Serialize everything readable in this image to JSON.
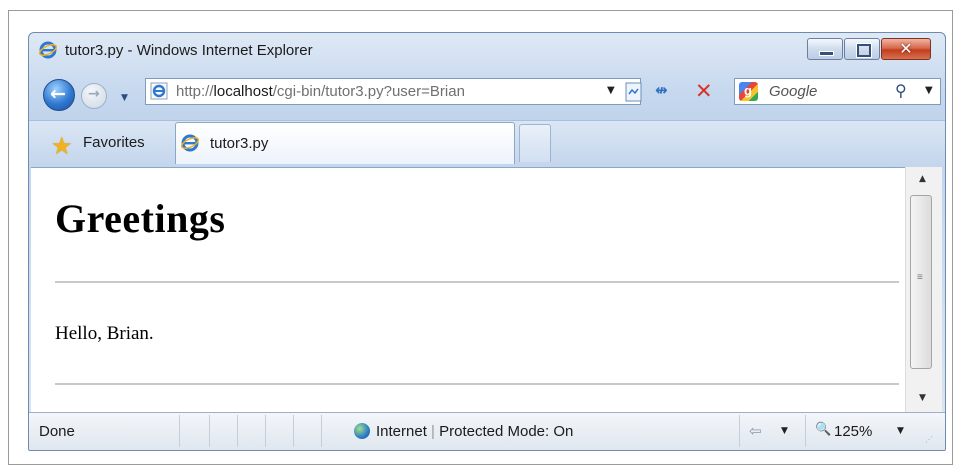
{
  "window": {
    "title": "tutor3.py - Windows Internet Explorer",
    "minimize_icon": "minimize-icon",
    "maximize_icon": "maximize-icon",
    "close_icon": "close-icon",
    "close_glyph": "✕"
  },
  "nav": {
    "back_icon": "back-arrow-icon",
    "back_glyph": "←",
    "forward_icon": "forward-arrow-icon",
    "forward_glyph": "→",
    "recent_glyph": "▼",
    "address_host_prefix": "http://",
    "address_host": "localhost",
    "address_path": "/cgi-bin/tutor3.py?user=Brian",
    "address_drop_glyph": "▼",
    "refresh_glyph": "↮",
    "stop_glyph": "✕"
  },
  "search": {
    "placeholder": "Google",
    "logo_letter": "g",
    "go_glyph": "⚲",
    "drop_glyph": "▼"
  },
  "toolbar": {
    "favorites_label": "Favorites",
    "star_glyph": "★",
    "tab_label": "tutor3.py"
  },
  "page": {
    "heading": "Greetings",
    "greeting": "Hello, Brian."
  },
  "scroll": {
    "up_glyph": "▲",
    "down_glyph": "▼",
    "grip_glyph": "≡"
  },
  "status": {
    "text": "Done",
    "zone": "Internet",
    "separator": "|",
    "protected_mode": "Protected Mode: On",
    "security_glyph": "⇦",
    "zoom_glyph": "🔍",
    "zoom": "125%",
    "drop_glyph": "▼",
    "grip_glyph": "⋰"
  },
  "colors": {
    "ie_blue": "#2f78d0",
    "stop_red": "#d8322b",
    "close_red": "#c23d1e",
    "star_gold": "#f0b21e"
  }
}
